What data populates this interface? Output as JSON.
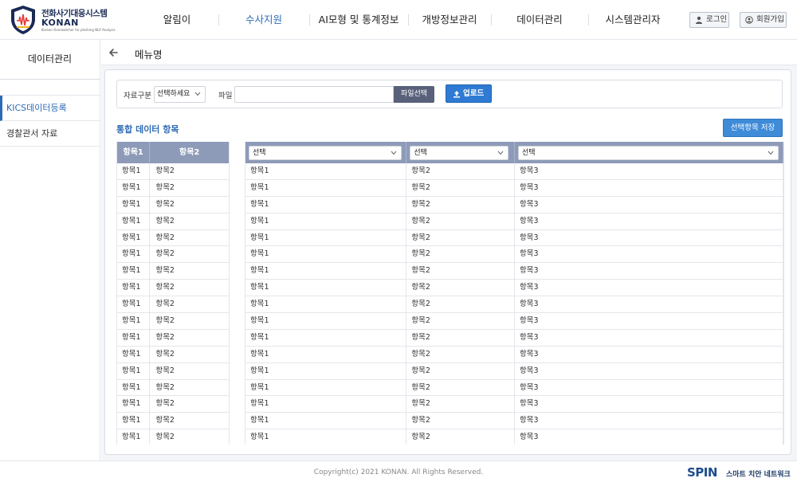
{
  "brand": {
    "title": "전화사기대응시스템",
    "name": "KONAN",
    "subtitle": "Korean Overwatcher for phishing NLP Analysis",
    "colors": {
      "primary": "#1a2a55",
      "accent": "#2d6bb5"
    }
  },
  "nav": {
    "items": [
      {
        "label": "알림이",
        "active": false
      },
      {
        "label": "수사지원",
        "active": true
      },
      {
        "label": "AI모형 및 통계정보",
        "active": false
      },
      {
        "label": "개방정보관리",
        "active": false
      },
      {
        "label": "데이터관리",
        "active": false
      },
      {
        "label": "시스템관리자",
        "active": false
      }
    ],
    "login_label": "로그인",
    "signup_label": "회원가입"
  },
  "sidebar": {
    "title": "데이터관리",
    "items": [
      {
        "label": "KICS데이터등록",
        "active": true
      },
      {
        "label": "경찰관서 자료",
        "active": false
      }
    ]
  },
  "page": {
    "title": "메뉴명"
  },
  "filter": {
    "type_label": "자료구분",
    "type_value": "선택하세요",
    "file_label": "파일",
    "file_value": "",
    "file_button": "파일선택",
    "upload_button": "업로드"
  },
  "section": {
    "title": "통합 데이터 항목",
    "save_button": "선택항목 저장"
  },
  "left_table": {
    "headers": [
      "항목1",
      "항목2"
    ],
    "rows": [
      [
        "항목1",
        "항목2"
      ],
      [
        "항목1",
        "항목2"
      ],
      [
        "항목1",
        "항목2"
      ],
      [
        "항목1",
        "항목2"
      ],
      [
        "항목1",
        "항목2"
      ],
      [
        "항목1",
        "항목2"
      ],
      [
        "항목1",
        "항목2"
      ],
      [
        "항목1",
        "항목2"
      ],
      [
        "항목1",
        "항목2"
      ],
      [
        "항목1",
        "항목2"
      ],
      [
        "항목1",
        "항목2"
      ],
      [
        "항목1",
        "항목2"
      ],
      [
        "항목1",
        "항목2"
      ],
      [
        "항목1",
        "항목2"
      ],
      [
        "항목1",
        "항목2"
      ],
      [
        "항목1",
        "항목2"
      ],
      [
        "항목1",
        "항목2"
      ]
    ]
  },
  "right_table": {
    "selects": [
      "선택",
      "선택",
      "선택"
    ],
    "rows": [
      [
        "항목1",
        "항목2",
        "항목3"
      ],
      [
        "항목1",
        "항목2",
        "항목3"
      ],
      [
        "항목1",
        "항목2",
        "항목3"
      ],
      [
        "항목1",
        "항목2",
        "항목3"
      ],
      [
        "항목1",
        "항목2",
        "항목3"
      ],
      [
        "항목1",
        "항목2",
        "항목3"
      ],
      [
        "항목1",
        "항목2",
        "항목3"
      ],
      [
        "항목1",
        "항목2",
        "항목3"
      ],
      [
        "항목1",
        "항목2",
        "항목3"
      ],
      [
        "항목1",
        "항목2",
        "항목3"
      ],
      [
        "항목1",
        "항목2",
        "항목3"
      ],
      [
        "항목1",
        "항목2",
        "항목3"
      ],
      [
        "항목1",
        "항목2",
        "항목3"
      ],
      [
        "항목1",
        "항목2",
        "항목3"
      ],
      [
        "항목1",
        "항목2",
        "항목3"
      ],
      [
        "항목1",
        "항목2",
        "항목3"
      ],
      [
        "항목1",
        "항목2",
        "항목3"
      ]
    ]
  },
  "footer": {
    "copyright": "Copyright(c) 2021 KONAN. All Rights Reserved.",
    "partner": "SPIN",
    "partner_sub": "스마트 치안 네트워크"
  },
  "icons": {
    "logo": "shield-logo-icon",
    "login": "user-icon",
    "signup": "user-circle-icon",
    "back": "arrow-left-icon",
    "select": "chevron-down-icon",
    "upload": "upload-icon"
  }
}
